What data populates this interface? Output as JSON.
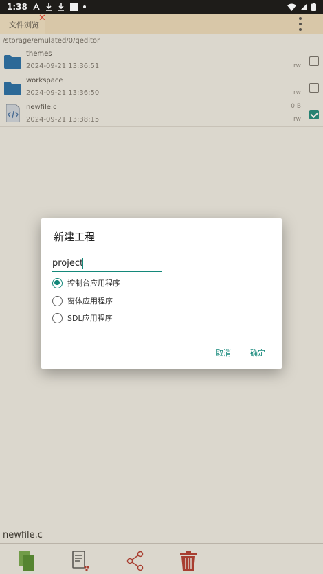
{
  "status_bar": {
    "time": "1:38"
  },
  "app_bar": {
    "tab_label": "文件浏览",
    "tab_close": "✕"
  },
  "path": "/storage/emulated/0/qeditor",
  "files": [
    {
      "name": "themes",
      "date": "2024-09-21 13:36:51",
      "size": "",
      "perm": "rw",
      "type": "folder",
      "checked": false
    },
    {
      "name": "workspace",
      "date": "2024-09-21 13:36:50",
      "size": "",
      "perm": "rw",
      "type": "folder",
      "checked": false
    },
    {
      "name": "newfile.c",
      "date": "2024-09-21 13:38:15",
      "size": "0 B",
      "perm": "rw",
      "type": "code",
      "checked": true
    }
  ],
  "bottom": {
    "filename": "newfile.c"
  },
  "dialog": {
    "title": "新建工程",
    "input_value": "project",
    "options": [
      {
        "label": "控制台应用程序",
        "selected": true
      },
      {
        "label": "窗体应用程序",
        "selected": false
      },
      {
        "label": "SDL应用程序",
        "selected": false
      }
    ],
    "cancel_label": "取消",
    "ok_label": "确定"
  },
  "colors": {
    "accent": "#14887a",
    "folder": "#1c69a8",
    "delete": "#b3352a",
    "copy": "#4e8a2b"
  }
}
